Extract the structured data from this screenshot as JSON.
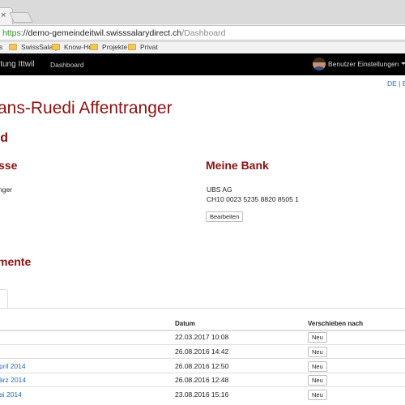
{
  "browser": {
    "tab_close": "×",
    "url": {
      "scheme": "https",
      "sep": "://",
      "host": "demo-gemeindeitwil.swisssalarydirect.ch",
      "path": "/Dashboard"
    },
    "bookmarks": [
      {
        "label": "SwissSalary",
        "icon": "folder-icon"
      },
      {
        "label": "Know-How",
        "icon": "folder-icon"
      },
      {
        "label": "Projekte",
        "icon": "folder-icon"
      },
      {
        "label": "Privat",
        "icon": "folder-icon"
      }
    ],
    "bookmark_bar_partial": "s"
  },
  "navbar": {
    "brand": "ltung Ittwil",
    "dashboard": "Dashboard",
    "user_menu": "Benutzer Einstellungen"
  },
  "lang": {
    "de": "DE",
    "sep": " | ",
    "en": "E"
  },
  "page": {
    "title": "ans-Ruedi Affentranger",
    "subtitle": "rd"
  },
  "address": {
    "heading": "sse",
    "line1": "nger"
  },
  "bank": {
    "heading": "Meine Bank",
    "name": "UBS AG",
    "iban": "CH10 0023 5235 8820 8505 1",
    "edit_button": "Bearbeiten"
  },
  "documents": {
    "heading": "mente",
    "columns": {
      "date": "Datum",
      "move": "Verschieben nach"
    },
    "rows": [
      {
        "name": "",
        "date": "22.03.2017 10:08",
        "button": "Neu"
      },
      {
        "name": "",
        "date": "26.08.2016 14:42",
        "button": "Neu"
      },
      {
        "name": "pril 2014",
        "date": "26.08.2016 12:50",
        "button": "Neu"
      },
      {
        "name": "ärz 2014",
        "date": "26.08.2016 12:48",
        "button": "Neu"
      },
      {
        "name": "ai 2014",
        "date": "23.08.2016 15:16",
        "button": "Neu"
      }
    ]
  },
  "colors": {
    "brand_red": "#8b1111",
    "link_blue": "#2a6bb0",
    "navbar_bg": "#000000"
  }
}
